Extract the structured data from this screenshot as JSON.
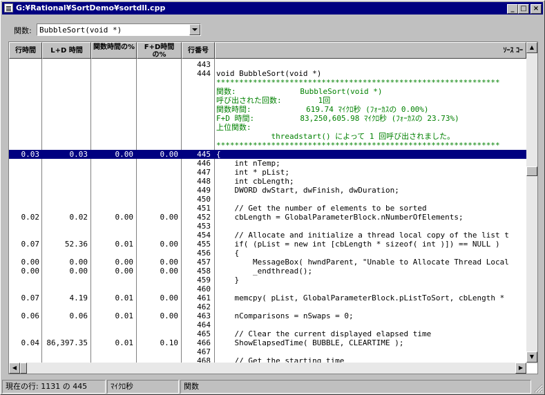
{
  "window": {
    "title": "G:¥Rational¥SortDemo¥sortdll.cpp"
  },
  "titlebar_buttons": {
    "min": "_",
    "max": "□",
    "close": "×"
  },
  "toolbar": {
    "function_label": "関数:",
    "function_value": "BubbleSort(void *)"
  },
  "columns": {
    "line_time": "行時間",
    "ld_time": "L+D 時間",
    "func_time_pct": "関数時間の%",
    "fd_time_pct": "F+D時間の%",
    "line_number": "行番号",
    "source": "ｿｰｽ ｺｰ"
  },
  "rows": [
    {
      "lt": "",
      "ld": "",
      "fp": "",
      "dp": "",
      "ln": "443",
      "src": ""
    },
    {
      "lt": "",
      "ld": "",
      "fp": "",
      "dp": "",
      "ln": "444",
      "src": "void BubbleSort(void *)"
    },
    {
      "lt": "",
      "ld": "",
      "fp": "",
      "dp": "",
      "ln": "",
      "src": "**************************************************************",
      "green": true
    },
    {
      "lt": "",
      "ld": "",
      "fp": "",
      "dp": "",
      "ln": "",
      "src": "関数:              BubbleSort(void *)",
      "green": true
    },
    {
      "lt": "",
      "ld": "",
      "fp": "",
      "dp": "",
      "ln": "",
      "src": "呼び出された回数:        1回",
      "green": true
    },
    {
      "lt": "",
      "ld": "",
      "fp": "",
      "dp": "",
      "ln": "",
      "src": "関数時間:            619.74 ﾏｲｸﾛ秒 (ﾌｫｰｶｽの 0.00%)",
      "green": true
    },
    {
      "lt": "",
      "ld": "",
      "fp": "",
      "dp": "",
      "ln": "",
      "src": "F+D 時間:          83,250,605.98 ﾏｲｸﾛ秒 (ﾌｫｰｶｽの 23.73%)",
      "green": true
    },
    {
      "lt": "",
      "ld": "",
      "fp": "",
      "dp": "",
      "ln": "",
      "src": "上位関数:",
      "green": true
    },
    {
      "lt": "",
      "ld": "",
      "fp": "",
      "dp": "",
      "ln": "",
      "src": "            threadstart() によって 1 回呼び出されました。",
      "green": true
    },
    {
      "lt": "",
      "ld": "",
      "fp": "",
      "dp": "",
      "ln": "",
      "src": "**************************************************************",
      "green": true
    },
    {
      "lt": "0.03",
      "ld": "0.03",
      "fp": "0.00",
      "dp": "0.00",
      "ln": "445",
      "src": "{",
      "sel": true
    },
    {
      "lt": "",
      "ld": "",
      "fp": "",
      "dp": "",
      "ln": "446",
      "src": "    int nTemp;"
    },
    {
      "lt": "",
      "ld": "",
      "fp": "",
      "dp": "",
      "ln": "447",
      "src": "    int * pList;"
    },
    {
      "lt": "",
      "ld": "",
      "fp": "",
      "dp": "",
      "ln": "448",
      "src": "    int cbLength;"
    },
    {
      "lt": "",
      "ld": "",
      "fp": "",
      "dp": "",
      "ln": "449",
      "src": "    DWORD dwStart, dwFinish, dwDuration;"
    },
    {
      "lt": "",
      "ld": "",
      "fp": "",
      "dp": "",
      "ln": "450",
      "src": ""
    },
    {
      "lt": "",
      "ld": "",
      "fp": "",
      "dp": "",
      "ln": "451",
      "src": "    // Get the number of elements to be sorted"
    },
    {
      "lt": "0.02",
      "ld": "0.02",
      "fp": "0.00",
      "dp": "0.00",
      "ln": "452",
      "src": "    cbLength = GlobalParameterBlock.nNumberOfElements;"
    },
    {
      "lt": "",
      "ld": "",
      "fp": "",
      "dp": "",
      "ln": "453",
      "src": ""
    },
    {
      "lt": "",
      "ld": "",
      "fp": "",
      "dp": "",
      "ln": "454",
      "src": "    // Allocate and initialize a thread local copy of the list t"
    },
    {
      "lt": "0.07",
      "ld": "52.36",
      "fp": "0.01",
      "dp": "0.00",
      "ln": "455",
      "src": "    if( (pList = new int [cbLength * sizeof( int )]) == NULL )"
    },
    {
      "lt": "",
      "ld": "",
      "fp": "",
      "dp": "",
      "ln": "456",
      "src": "    {"
    },
    {
      "lt": "0.00",
      "ld": "0.00",
      "fp": "0.00",
      "dp": "0.00",
      "ln": "457",
      "src": "        MessageBox( hwndParent, \"Unable to Allocate Thread Local"
    },
    {
      "lt": "0.00",
      "ld": "0.00",
      "fp": "0.00",
      "dp": "0.00",
      "ln": "458",
      "src": "        _endthread();"
    },
    {
      "lt": "",
      "ld": "",
      "fp": "",
      "dp": "",
      "ln": "459",
      "src": "    }"
    },
    {
      "lt": "",
      "ld": "",
      "fp": "",
      "dp": "",
      "ln": "460",
      "src": ""
    },
    {
      "lt": "0.07",
      "ld": "4.19",
      "fp": "0.01",
      "dp": "0.00",
      "ln": "461",
      "src": "    memcpy( pList, GlobalParameterBlock.pListToSort, cbLength *"
    },
    {
      "lt": "",
      "ld": "",
      "fp": "",
      "dp": "",
      "ln": "462",
      "src": ""
    },
    {
      "lt": "0.06",
      "ld": "0.06",
      "fp": "0.01",
      "dp": "0.00",
      "ln": "463",
      "src": "    nComparisons = nSwaps = 0;"
    },
    {
      "lt": "",
      "ld": "",
      "fp": "",
      "dp": "",
      "ln": "464",
      "src": ""
    },
    {
      "lt": "",
      "ld": "",
      "fp": "",
      "dp": "",
      "ln": "465",
      "src": "    // Clear the current displayed elapsed time"
    },
    {
      "lt": "0.04",
      "ld": "86,397.35",
      "fp": "0.01",
      "dp": "0.10",
      "ln": "466",
      "src": "    ShowElapsedTime( BUBBLE, CLEARTIME );"
    },
    {
      "lt": "",
      "ld": "",
      "fp": "",
      "dp": "",
      "ln": "467",
      "src": ""
    },
    {
      "lt": "",
      "ld": "",
      "fp": "",
      "dp": "",
      "ln": "468",
      "src": "    // Get the starting time"
    }
  ],
  "status": {
    "current_line": "現在の行: 1131 の 445",
    "unit": "ﾏｲｸﾛ秒",
    "type": "関数"
  },
  "scroll_glyphs": {
    "up": "▲",
    "down": "▼",
    "left": "◀",
    "right": "▶"
  },
  "colors": {
    "selection": "#000080",
    "comment_block": "#008000",
    "titlebar": "#000080"
  }
}
